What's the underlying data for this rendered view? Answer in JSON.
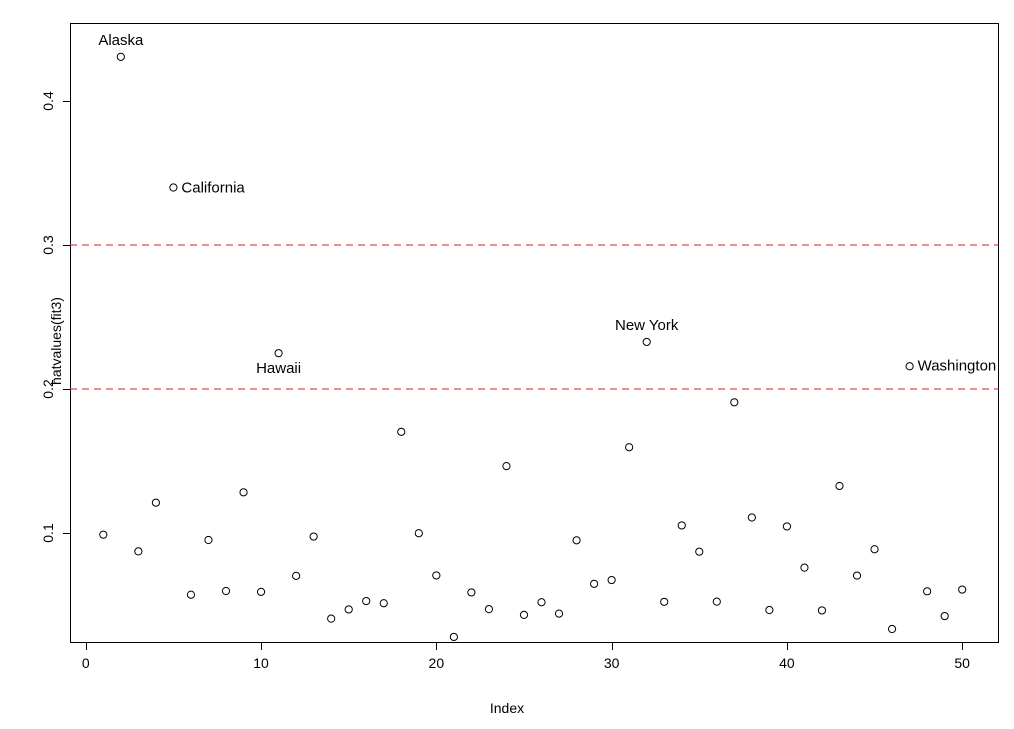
{
  "chart_data": {
    "type": "scatter",
    "title": "",
    "xlabel": "Index",
    "ylabel": "hatvalues(fit3)",
    "xlim": [
      -0.9,
      52.1
    ],
    "ylim": [
      0.0237,
      0.4541
    ],
    "xticks": [
      0,
      10,
      20,
      30,
      40,
      50
    ],
    "yticks": [
      0.1,
      0.2,
      0.3,
      0.4
    ],
    "xtick_labels": [
      "0",
      "10",
      "20",
      "30",
      "40",
      "50"
    ],
    "ytick_labels": [
      "0.1",
      "0.2",
      "0.3",
      "0.4"
    ],
    "grid": false,
    "legend": "none",
    "point_marker": "open-circle",
    "point_color": "#000000",
    "hlines": [
      {
        "value": 0.3,
        "color": "#CD2626",
        "style": "dashed"
      },
      {
        "value": 0.2,
        "color": "#CD2626",
        "style": "dashed"
      }
    ],
    "x": [
      1,
      2,
      3,
      4,
      5,
      6,
      7,
      8,
      9,
      10,
      11,
      12,
      13,
      14,
      15,
      16,
      17,
      18,
      19,
      20,
      21,
      22,
      23,
      24,
      25,
      26,
      27,
      28,
      29,
      30,
      31,
      32,
      33,
      34,
      35,
      36,
      37,
      38,
      39,
      40,
      41,
      42,
      43,
      44,
      45,
      46,
      47,
      48,
      49,
      50
    ],
    "y": [
      0.0989,
      0.4306,
      0.0873,
      0.1211,
      0.3399,
      0.0572,
      0.0952,
      0.0598,
      0.1283,
      0.0592,
      0.2249,
      0.0703,
      0.0976,
      0.0406,
      0.047,
      0.0528,
      0.0513,
      0.1703,
      0.0999,
      0.0706,
      0.0279,
      0.0588,
      0.0472,
      0.1465,
      0.0432,
      0.052,
      0.0441,
      0.095,
      0.0648,
      0.0674,
      0.1596,
      0.2327,
      0.0523,
      0.1053,
      0.0871,
      0.0524,
      0.1908,
      0.1108,
      0.0466,
      0.1046,
      0.076,
      0.0463,
      0.1327,
      0.0705,
      0.0888,
      0.0334,
      0.2158,
      0.0596,
      0.0424,
      0.0608
    ],
    "labeled_points": [
      {
        "name": "Alaska",
        "x": 2,
        "y": 0.4306,
        "label_position": "above"
      },
      {
        "name": "California",
        "x": 5,
        "y": 0.3399,
        "label_position": "right"
      },
      {
        "name": "Hawaii",
        "x": 11,
        "y": 0.2249,
        "label_position": "below"
      },
      {
        "name": "New York",
        "x": 32,
        "y": 0.2327,
        "label_position": "above"
      },
      {
        "name": "Washington",
        "x": 47,
        "y": 0.2158,
        "label_position": "right"
      }
    ]
  },
  "axes": {
    "xlabel": "Index",
    "ylabel": "hatvalues(fit3)"
  }
}
